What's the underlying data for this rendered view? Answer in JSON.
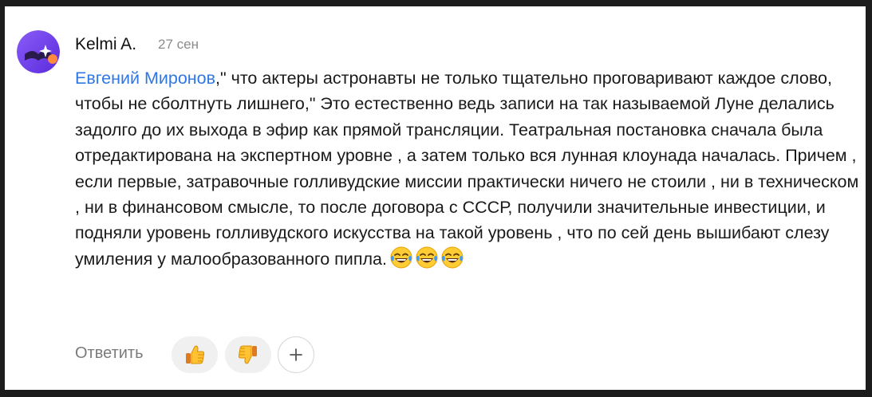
{
  "comment": {
    "author": "Kelmi A.",
    "date": "27 сен",
    "mention": "Евгений Миронов",
    "text": ",\" что актеры астронавты не только тщательно проговаривают каждое слово, чтобы не сболтнуть лишнего,\" Это естественно ведь записи на так называемой Луне делались задолго до их выхода в эфир как прямой трансляции. Театральная постановка сначала была отредактирована на экспертном уровне , а затем только вся лунная клоунада началась. Причем , если первые, затравочные голливудские миссии практически ничего не стоили , ни в техническом , ни в финансовом смысле, то после договора с СССР, получили значительные инвестиции, и подняли уровень голливудского искусства на такой уровень , что по сей день вышибают слезу умиления у малообразованного пипла.",
    "emojis": [
      "laughing-with-tears-emoji",
      "laughing-with-tears-emoji",
      "laughing-with-tears-emoji"
    ]
  },
  "actions": {
    "reply_label": "Ответить",
    "like_icon": "thumbs-up-icon",
    "dislike_icon": "thumbs-down-icon",
    "add_reaction_icon": "plus-icon"
  },
  "colors": {
    "mention": "#2f77e3",
    "muted": "#8c8c8c",
    "pill_bg": "#f0f0f0",
    "avatar_gradient_start": "#7a4df5",
    "avatar_gradient_end": "#5f2fe0"
  }
}
